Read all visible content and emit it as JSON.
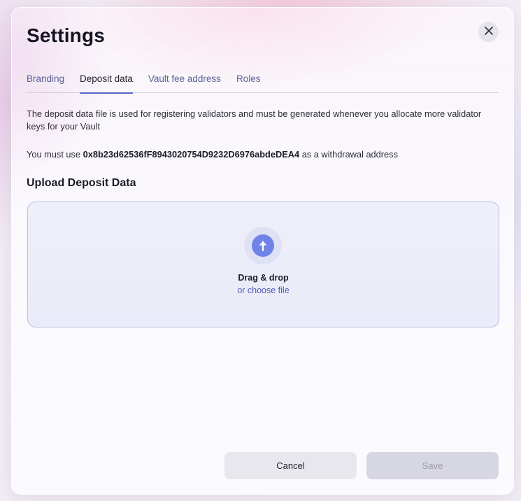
{
  "modal": {
    "title": "Settings"
  },
  "tabs": [
    {
      "label": "Branding",
      "active": false
    },
    {
      "label": "Deposit data",
      "active": true
    },
    {
      "label": "Vault fee address",
      "active": false
    },
    {
      "label": "Roles",
      "active": false
    }
  ],
  "content": {
    "description": "The deposit data file is used for registering validators and must be generated whenever you allocate more validator keys for your Vault",
    "address_prefix": "You must use",
    "withdrawal_address": "0x8b23d62536fF8943020754D9232D6976abdeDEA4",
    "address_suffix": "as a withdrawal address",
    "section_title": "Upload Deposit Data"
  },
  "upload": {
    "drag_label": "Drag & drop",
    "choose_label": "or choose file",
    "icon": "arrow-up-icon"
  },
  "footer": {
    "cancel_label": "Cancel",
    "save_label": "Save",
    "save_disabled": true
  },
  "colors": {
    "accent": "#5566c8",
    "upload_icon": "#6e83e6",
    "link": "#4a5bbd"
  }
}
